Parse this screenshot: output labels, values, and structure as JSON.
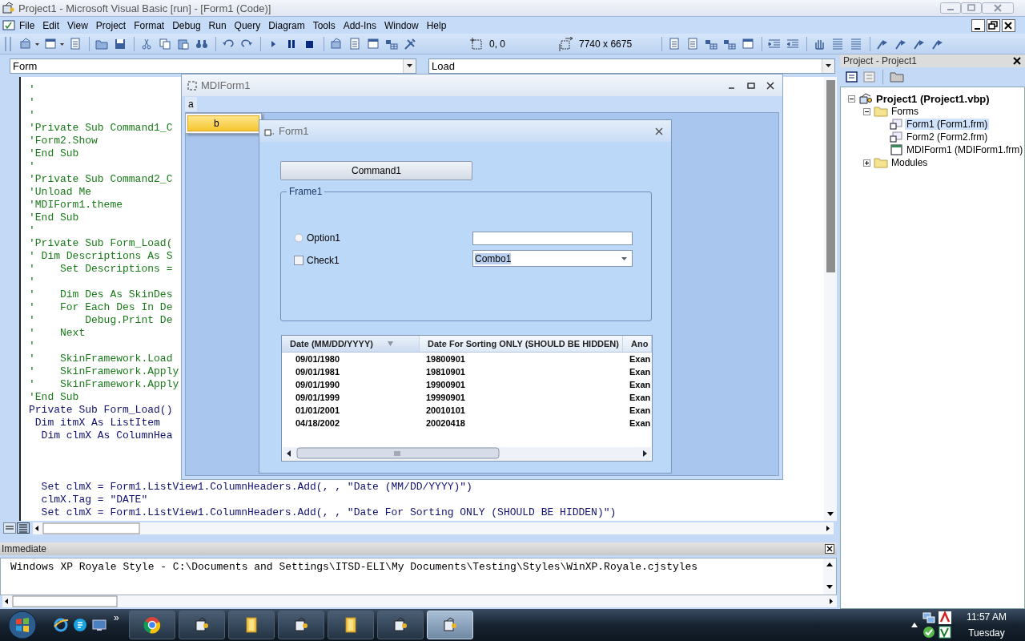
{
  "window": {
    "title": "Project1 - Microsoft Visual Basic [run] - [Form1 (Code)]"
  },
  "menu": [
    "File",
    "Edit",
    "View",
    "Project",
    "Format",
    "Debug",
    "Run",
    "Query",
    "Diagram",
    "Tools",
    "Add-Ins",
    "Window",
    "Help"
  ],
  "toolbar": {
    "position": "0, 0",
    "size": "7740 x 6675"
  },
  "code_window": {
    "object": "Form",
    "procedure": "Load",
    "lines": [
      {
        "kind": "comment",
        "text": "'"
      },
      {
        "kind": "comment",
        "text": "'"
      },
      {
        "kind": "comment",
        "text": "'"
      },
      {
        "kind": "comment",
        "text": "'Private Sub Command1_C"
      },
      {
        "kind": "comment",
        "text": "'Form2.Show"
      },
      {
        "kind": "comment",
        "text": "'End Sub"
      },
      {
        "kind": "comment",
        "text": "'"
      },
      {
        "kind": "comment",
        "text": "'Private Sub Command2_C"
      },
      {
        "kind": "comment",
        "text": "'Unload Me"
      },
      {
        "kind": "comment",
        "text": "'MDIForm1.theme"
      },
      {
        "kind": "comment",
        "text": "'End Sub"
      },
      {
        "kind": "comment",
        "text": "'"
      },
      {
        "kind": "comment",
        "text": "'Private Sub Form_Load("
      },
      {
        "kind": "comment",
        "text": "' Dim Descriptions As S"
      },
      {
        "kind": "comment",
        "text": "'    Set Descriptions ="
      },
      {
        "kind": "comment",
        "text": "'"
      },
      {
        "kind": "comment",
        "text": "'    Dim Des As SkinDes"
      },
      {
        "kind": "comment",
        "text": "'    For Each Des In De"
      },
      {
        "kind": "comment",
        "text": "'        Debug.Print De"
      },
      {
        "kind": "comment",
        "text": "'    Next"
      },
      {
        "kind": "comment",
        "text": "'"
      },
      {
        "kind": "comment",
        "text": "'    SkinFramework.Load"
      },
      {
        "kind": "comment",
        "text": "'    SkinFramework.Apply"
      },
      {
        "kind": "comment",
        "text": "'    SkinFramework.Apply"
      },
      {
        "kind": "comment",
        "text": "'End Sub"
      },
      {
        "kind": "code",
        "text": "Private Sub Form_Load()"
      },
      {
        "kind": "code",
        "text": " Dim itmX As ListItem"
      },
      {
        "kind": "code",
        "text": "  Dim clmX As ColumnHea"
      },
      {
        "kind": "blank"
      },
      {
        "kind": "blank"
      },
      {
        "kind": "blank"
      },
      {
        "kind": "code",
        "text": "  Set clmX = Form1.ListView1.ColumnHeaders.Add(, , \"Date (MM/DD/YYYY)\")"
      },
      {
        "kind": "code",
        "text": "  clmX.Tag = \"DATE\""
      },
      {
        "kind": "code",
        "text": "  Set clmX = Form1.ListView1.ColumnHeaders.Add(, , \"Date For Sorting ONLY (SHOULD BE HIDDEN)\")"
      }
    ]
  },
  "mdi_form": {
    "title": "MDIForm1",
    "menu": [
      {
        "label": "a",
        "expanded": true,
        "items": [
          {
            "label": "b",
            "selected": true
          }
        ]
      }
    ]
  },
  "form1": {
    "title": "Form1",
    "command": "Command1",
    "frame": "Frame1",
    "option": {
      "label": "Option1",
      "selected": false
    },
    "check": {
      "label": "Check1",
      "checked": false
    },
    "combo": {
      "value": "Combo1",
      "highlighted": true
    },
    "list": {
      "columns": [
        {
          "label": "Date (MM/DD/YYYY)",
          "sorted": true
        },
        {
          "label": "Date For Sorting ONLY (SHOULD BE HIDDEN)",
          "sorted": false
        },
        {
          "label": "Ano",
          "sorted": false
        }
      ],
      "rows": [
        [
          "09/01/1980",
          "19800901",
          "Exan"
        ],
        [
          "09/01/1981",
          "19810901",
          "Exan"
        ],
        [
          "09/01/1990",
          "19900901",
          "Exan"
        ],
        [
          "09/01/1999",
          "19990901",
          "Exan"
        ],
        [
          "01/01/2001",
          "20010101",
          "Exan"
        ],
        [
          "04/18/2002",
          "20020418",
          "Exan"
        ]
      ]
    }
  },
  "project": {
    "title": "Project - Project1",
    "tree": [
      {
        "label": "Project1 (Project1.vbp)",
        "kind": "project",
        "expanded": true,
        "selected": false,
        "children": [
          {
            "label": "Forms",
            "kind": "folder",
            "expanded": true,
            "selected": false,
            "children": [
              {
                "label": "Form1 (Form1.frm)",
                "kind": "form",
                "selected": true
              },
              {
                "label": "Form2 (Form2.frm)",
                "kind": "form",
                "selected": false
              },
              {
                "label": "MDIForm1 (MDIForm1.frm)",
                "kind": "mdiform",
                "selected": false
              }
            ]
          },
          {
            "label": "Modules",
            "kind": "folder",
            "expanded": false,
            "selected": false
          }
        ]
      }
    ]
  },
  "immediate": {
    "title": "Immediate",
    "lines": [
      "Windows XP Royale Style - C:\\Documents and Settings\\ITSD-ELI\\My Documents\\Testing\\Styles\\WinXP.Royale.cjstyles"
    ]
  },
  "taskbar": {
    "overflow": "»",
    "buttons": [
      {
        "kind": "browser",
        "selected": false
      },
      {
        "kind": "vb",
        "selected": false
      },
      {
        "kind": "folder",
        "selected": false
      },
      {
        "kind": "vb",
        "selected": false
      },
      {
        "kind": "folder",
        "selected": false
      },
      {
        "kind": "vb",
        "selected": false
      },
      {
        "kind": "vb",
        "selected": true
      }
    ],
    "time": "11:57 AM",
    "day": "Tuesday"
  }
}
